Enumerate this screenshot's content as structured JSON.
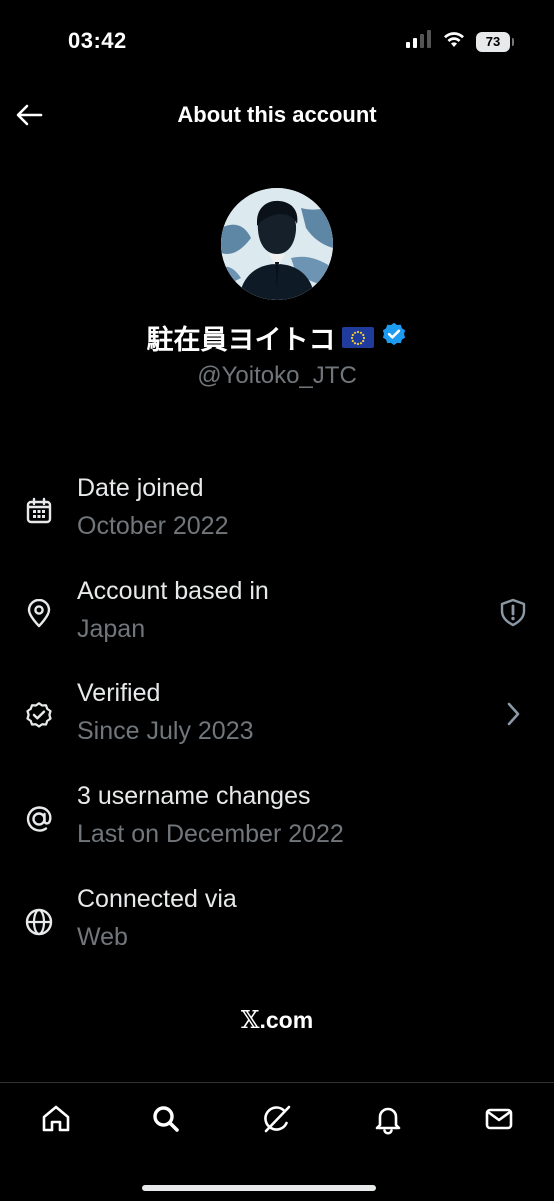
{
  "status_bar": {
    "time": "03:42",
    "battery": "73",
    "icons": [
      "cellular-icon",
      "wifi-icon",
      "battery-icon"
    ]
  },
  "header": {
    "title": "About this account",
    "back_icon": "back-arrow-icon"
  },
  "profile": {
    "display_name": "駐在員ヨイトコ",
    "flag": "eu-flag-icon",
    "verified_badge": "verified-badge-icon",
    "handle": "@Yoitoko_JTC"
  },
  "info": [
    {
      "icon": "calendar-icon",
      "title": "Date joined",
      "subtitle": "October 2022"
    },
    {
      "icon": "location-pin-icon",
      "title": "Account based in",
      "subtitle": "Japan",
      "trailing": "shield-alert-icon"
    },
    {
      "icon": "verified-icon",
      "title": "Verified",
      "subtitle": "Since July 2023",
      "trailing": "chevron-right-icon"
    },
    {
      "icon": "at-sign-icon",
      "title": "3 username changes",
      "subtitle": "Last on December 2022"
    },
    {
      "icon": "globe-icon",
      "title": "Connected via",
      "subtitle": "Web"
    }
  ],
  "footer": {
    "brand_mark": "𝕏",
    "brand_text": ".com"
  },
  "tab_bar": {
    "tabs": [
      "home-icon",
      "search-icon",
      "grok-icon",
      "notifications-icon",
      "messages-icon"
    ]
  },
  "colors": {
    "background": "#000000",
    "primary_text": "#e7e9ea",
    "secondary_text": "#71767b",
    "verified_blue": "#1d9bf0",
    "divider": "#2f3336"
  }
}
